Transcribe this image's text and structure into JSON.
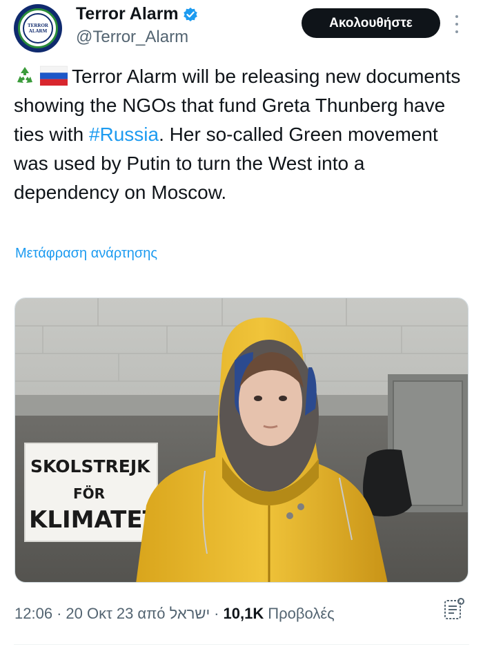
{
  "account": {
    "name": "Terror Alarm",
    "handle": "@Terror_Alarm",
    "avatar_text_top": "TERROR",
    "avatar_text_bottom": "ALARM",
    "verified": true,
    "verified_color": "#1d9bf0"
  },
  "follow_button": {
    "label": "Ακολουθήστε"
  },
  "tweet": {
    "emojis": [
      "recycle-icon",
      "russia-flag-icon"
    ],
    "text_before_hashtag": "Terror Alarm will be releasing new documents showing the NGOs that fund Greta Thunberg have ties with ",
    "hashtag": "#Russia",
    "text_after_hashtag": ". Her so-called Green movement was used by Putin to turn the West into a dependency on Moscow."
  },
  "translate_link": "Μετάφραση ανάρτησης",
  "photo": {
    "sign_line1": "SKOLSTREJK",
    "sign_line2": "FÖR",
    "sign_line3": "KLIMATET"
  },
  "meta": {
    "time": "12:06",
    "date": "20 Οκτ 23",
    "location": "από ישראל",
    "views_count": "10,1K",
    "views_label": "Προβολές"
  },
  "colors": {
    "accent": "#1d9bf0",
    "text": "#0f1419",
    "muted": "#536471"
  }
}
